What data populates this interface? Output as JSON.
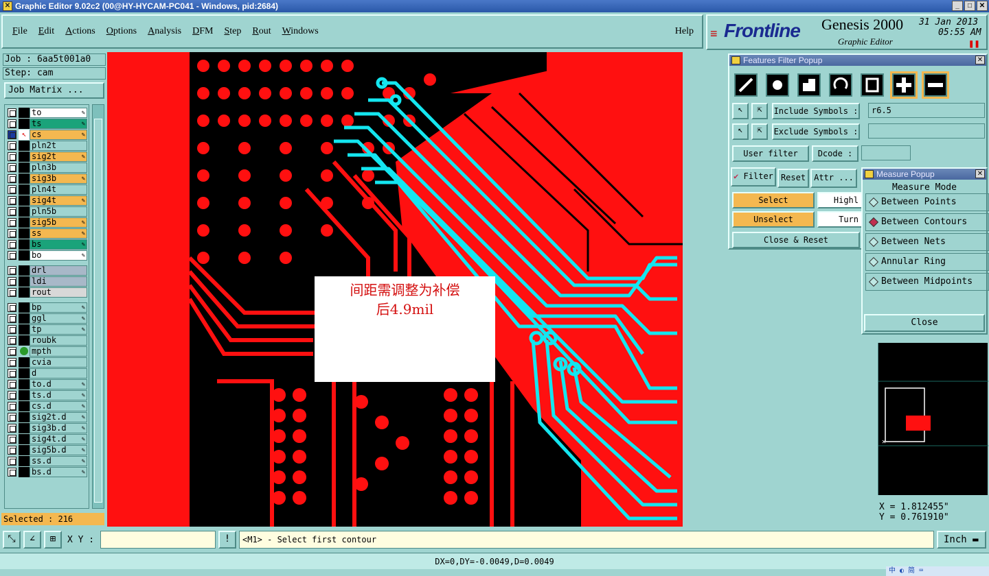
{
  "window": {
    "title": "Graphic Editor 9.02c2 (00@HY-HYCAM-PC041 - Windows, pid:2684)"
  },
  "menu": {
    "items": [
      "File",
      "Edit",
      "Actions",
      "Options",
      "Analysis",
      "DFM",
      "Step",
      "Rout",
      "Windows"
    ],
    "help": "Help"
  },
  "brand": {
    "logo": "Frontline",
    "product": "Genesis 2000",
    "subtitle": "Graphic Editor",
    "date": "31 Jan 2013",
    "time": "05:55 AM"
  },
  "job": {
    "job_label": "Job : 6aa5t001a0",
    "step_label": "Step: cam",
    "matrix_button": "Job Matrix ..."
  },
  "layers": [
    {
      "name": "to",
      "color": "#ffffff",
      "edit": true
    },
    {
      "name": "ts",
      "color": "#1aa37a",
      "edit": true
    },
    {
      "name": "cs",
      "color": "#f4b850",
      "edit": true,
      "work": true
    },
    {
      "name": "pln2t",
      "color": "#9fd4d0",
      "edit": false
    },
    {
      "name": "sig2t",
      "color": "#f4b850",
      "edit": true
    },
    {
      "name": "pln3b",
      "color": "#9fd4d0",
      "edit": false
    },
    {
      "name": "sig3b",
      "color": "#f4b850",
      "edit": true
    },
    {
      "name": "pln4t",
      "color": "#9fd4d0",
      "edit": false
    },
    {
      "name": "sig4t",
      "color": "#f4b850",
      "edit": true
    },
    {
      "name": "pln5b",
      "color": "#9fd4d0",
      "edit": false
    },
    {
      "name": "sig5b",
      "color": "#f4b850",
      "edit": true
    },
    {
      "name": "ss",
      "color": "#f4b850",
      "edit": true
    },
    {
      "name": "bs",
      "color": "#1aa37a",
      "edit": true
    },
    {
      "name": "bo",
      "color": "#ffffff",
      "edit": true
    },
    {
      "name": "drl",
      "color": "#a8b8c8",
      "edit": false
    },
    {
      "name": "ldi",
      "color": "#a8b8c8",
      "edit": false
    },
    {
      "name": "rout",
      "color": "#d8d8d8",
      "edit": false
    },
    {
      "name": "bp",
      "color": "#9fd4d0",
      "edit": true
    },
    {
      "name": "ggl",
      "color": "#9fd4d0",
      "edit": true
    },
    {
      "name": "tp",
      "color": "#9fd4d0",
      "edit": true
    },
    {
      "name": "roubk",
      "color": "#9fd4d0",
      "edit": false
    },
    {
      "name": "mpth",
      "color": "#9fd4d0",
      "edit": false,
      "dot": true
    },
    {
      "name": "cvia",
      "color": "#9fd4d0",
      "edit": false
    },
    {
      "name": "d",
      "color": "#9fd4d0",
      "edit": false
    },
    {
      "name": "to.d",
      "color": "#9fd4d0",
      "edit": true
    },
    {
      "name": "ts.d",
      "color": "#9fd4d0",
      "edit": true
    },
    {
      "name": "cs.d",
      "color": "#9fd4d0",
      "edit": true
    },
    {
      "name": "sig2t.d",
      "color": "#9fd4d0",
      "edit": true
    },
    {
      "name": "sig3b.d",
      "color": "#9fd4d0",
      "edit": true
    },
    {
      "name": "sig4t.d",
      "color": "#9fd4d0",
      "edit": true
    },
    {
      "name": "sig5b.d",
      "color": "#9fd4d0",
      "edit": true
    },
    {
      "name": "ss.d",
      "color": "#9fd4d0",
      "edit": true
    },
    {
      "name": "bs.d",
      "color": "#9fd4d0",
      "edit": true
    }
  ],
  "selected": "Selected : 216",
  "note": {
    "line1": "间距需调整为补偿",
    "line2": "后4.9mil"
  },
  "features_filter": {
    "title": "Features Filter Popup",
    "include_label": "Include Symbols :",
    "include_value": "r6.5",
    "exclude_label": "Exclude Symbols :",
    "exclude_value": "",
    "user_filter": "User filter ...",
    "dcode_label": "Dcode :",
    "filter": "Filter",
    "reset": "Reset",
    "attr": "Attr ...",
    "select": "Select",
    "unselect": "Unselect",
    "highlight": "Highl",
    "turn": "Turn",
    "close_reset": "Close & Reset"
  },
  "measure": {
    "title": "Measure Popup",
    "mode_label": "Measure Mode",
    "modes": [
      "Between Points",
      "Between Contours",
      "Between Nets",
      "Annular Ring",
      "Between Midpoints"
    ],
    "active_mode": 1,
    "close": "Close"
  },
  "coords": {
    "x": "X = 1.812455\"",
    "y": "Y = 0.761910\""
  },
  "command": {
    "xy_label": "X Y :",
    "prompt": "<M1> - Select first contour",
    "unit": "Inch"
  },
  "status": "DX=0,DY=-0.0049,D=0.0049",
  "tray": "中 ◐ 简 ⌨"
}
